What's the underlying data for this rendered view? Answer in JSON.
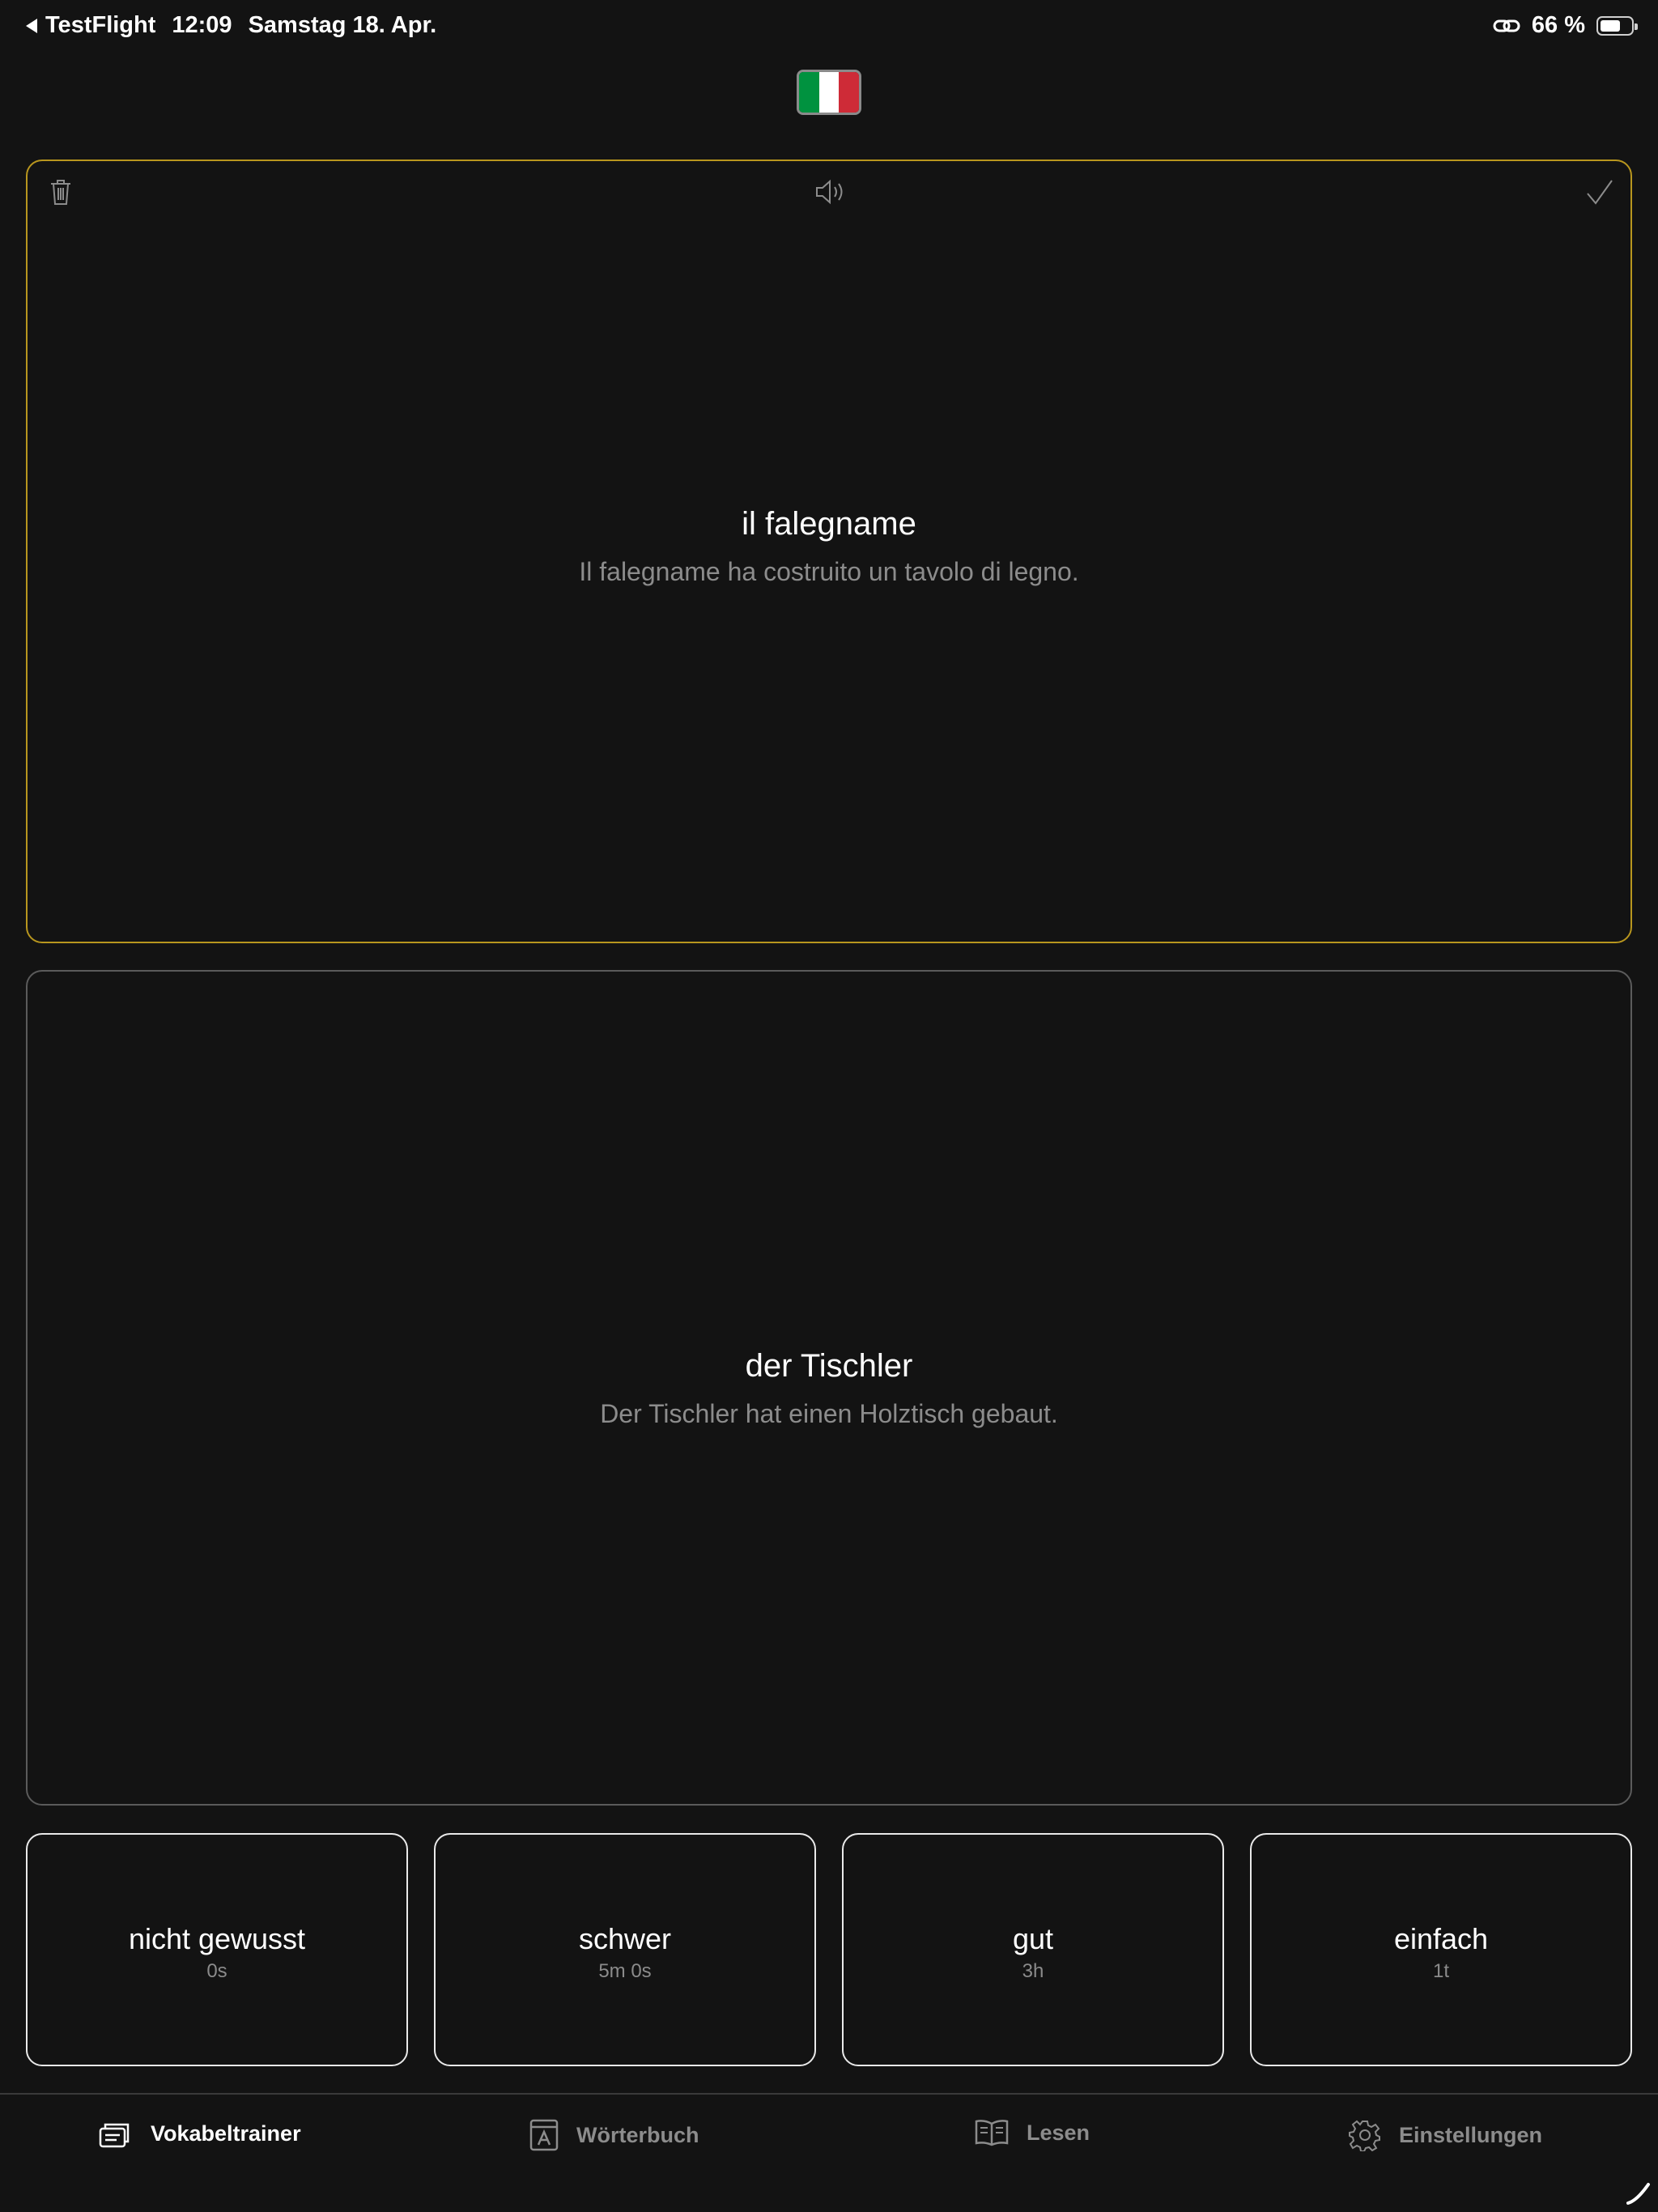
{
  "status_bar": {
    "back_app": "TestFlight",
    "time": "12:09",
    "date": "Samstag 18. Apr.",
    "battery_percent": "66 %",
    "battery_level": 0.66
  },
  "language_flag": {
    "name": "italian-flag",
    "colors": [
      "#00923f",
      "#ffffff",
      "#ce2b37"
    ]
  },
  "front_card": {
    "border_color": "#b8961e",
    "word": "il falegname",
    "sentence": "Il falegname ha costruito un tavolo di legno.",
    "icons": [
      "trash-icon",
      "speaker-icon",
      "checkmark-icon"
    ]
  },
  "back_card": {
    "word": "der Tischler",
    "sentence": "Der Tischler hat einen Holztisch gebaut."
  },
  "answers": [
    {
      "label": "nicht gewusst",
      "interval": "0s"
    },
    {
      "label": "schwer",
      "interval": "5m 0s"
    },
    {
      "label": "gut",
      "interval": "3h"
    },
    {
      "label": "einfach",
      "interval": "1t"
    }
  ],
  "tabs": [
    {
      "label": "Vokabeltrainer",
      "icon": "cards-icon",
      "active": true
    },
    {
      "label": "Wörterbuch",
      "icon": "dictionary-icon",
      "active": false
    },
    {
      "label": "Lesen",
      "icon": "book-icon",
      "active": false
    },
    {
      "label": "Einstellungen",
      "icon": "gear-icon",
      "active": false
    }
  ]
}
